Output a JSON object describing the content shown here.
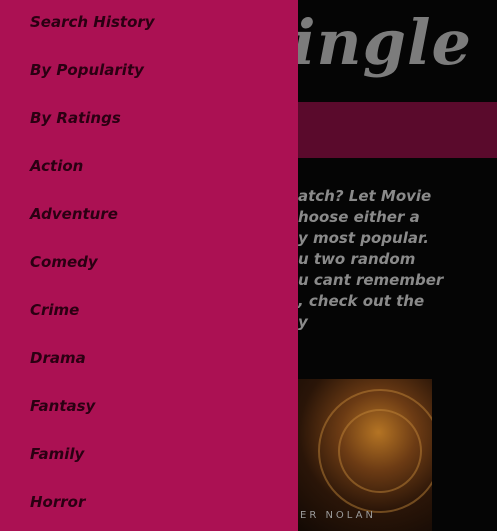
{
  "page": {
    "title": "ingle",
    "intro_lines": [
      "atch? Let Movie",
      "hoose either a",
      "y most popular.",
      "u two random",
      "u cant remember",
      ", check out the",
      "y"
    ],
    "poster_credit": "ER NOLAN"
  },
  "drawer": {
    "items": [
      {
        "label": "Search History"
      },
      {
        "label": "By Popularity"
      },
      {
        "label": "By Ratings"
      },
      {
        "label": "Action"
      },
      {
        "label": "Adventure"
      },
      {
        "label": "Comedy"
      },
      {
        "label": "Crime"
      },
      {
        "label": "Drama"
      },
      {
        "label": "Fantasy"
      },
      {
        "label": "Family"
      },
      {
        "label": "Horror"
      }
    ]
  },
  "colors": {
    "drawer_bg": "#ab1153",
    "band": "#5a0a2c",
    "page_bg": "#050505"
  }
}
